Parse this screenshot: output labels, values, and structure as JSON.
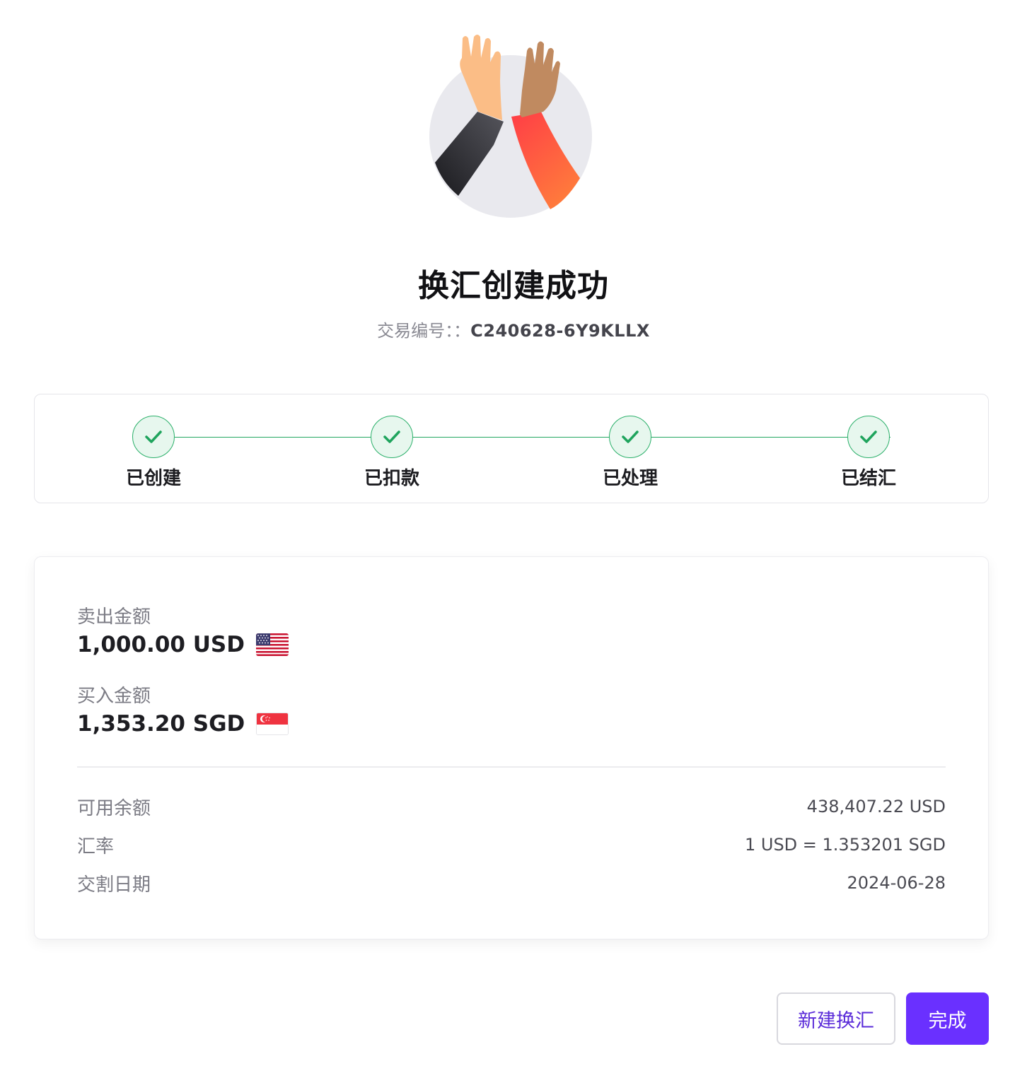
{
  "header": {
    "title": "换汇创建成功",
    "txn_label": "交易编号：：",
    "txn_id": "C240628-6Y9KLLX"
  },
  "steps": [
    {
      "label": "已创建",
      "status": "done"
    },
    {
      "label": "已扣款",
      "status": "done"
    },
    {
      "label": "已处理",
      "status": "done"
    },
    {
      "label": "已结汇",
      "status": "done"
    }
  ],
  "sell": {
    "label": "卖出金额",
    "value": "1,000.00 USD",
    "flag": "us-flag-icon"
  },
  "buy": {
    "label": "买入金额",
    "value": "1,353.20 SGD",
    "flag": "sg-flag-icon"
  },
  "details": [
    {
      "key": "可用余额",
      "value": "438,407.22 USD"
    },
    {
      "key": "汇率",
      "value": "1 USD = 1.353201 SGD"
    },
    {
      "key": "交割日期",
      "value": "2024-06-28"
    }
  ],
  "actions": {
    "new_label": "新建换汇",
    "done_label": "完成"
  },
  "colors": {
    "accent": "#6a30ff",
    "success": "#23a862",
    "success_bg": "#e7f7ee"
  }
}
